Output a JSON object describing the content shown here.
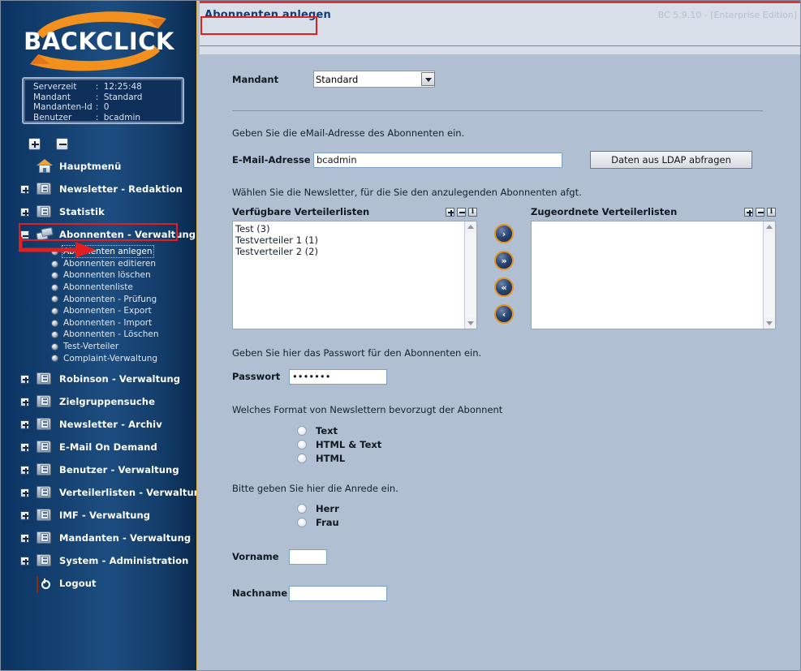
{
  "app": {
    "logo_text": "BACKCLICK",
    "version": "BC 5.9.10 - [Enterprise Edition]",
    "accent_orange": "#e8a33d",
    "sidebar_blue": "#14406f",
    "annotation_red": "#e02020",
    "body_blue": "#b0c0d2",
    "header_grey": "#d8dfe8"
  },
  "server_info": {
    "rows": [
      {
        "key": "Serverzeit",
        "sep": ":",
        "value": "12:25:48"
      },
      {
        "key": "Mandant",
        "sep": ":",
        "value": "Standard"
      },
      {
        "key": "Mandanten-Id",
        "sep": ":",
        "value": "0"
      },
      {
        "key": "Benutzer",
        "sep": ":",
        "value": "bcadmin"
      }
    ]
  },
  "tree_tools": {
    "expand_all": "expand-all-icon",
    "collapse_all": "collapse-all-icon"
  },
  "sidebar": {
    "items": [
      {
        "label": "Hauptmenü",
        "icon": "house-icon",
        "twisty": "none",
        "children": []
      },
      {
        "label": "Newsletter - Redaktion",
        "icon": "folder-icon",
        "twisty": "plus",
        "children": []
      },
      {
        "label": "Statistik",
        "icon": "folder-icon",
        "twisty": "plus",
        "children": []
      },
      {
        "label": "Abonnenten - Verwaltung",
        "icon": "cards-icon",
        "twisty": "minus",
        "highlighted": true,
        "children": [
          {
            "label": "Abonnenten anlegen",
            "selected": true
          },
          {
            "label": "Abonnenten editieren"
          },
          {
            "label": "Abonnenten löschen"
          },
          {
            "label": "Abonnentenliste"
          },
          {
            "label": "Abonnenten - Prüfung"
          },
          {
            "label": "Abonnenten - Export"
          },
          {
            "label": "Abonnenten - Import"
          },
          {
            "label": "Abonnenten - Löschen"
          },
          {
            "label": "Test-Verteiler"
          },
          {
            "label": "Complaint-Verwaltung"
          }
        ]
      },
      {
        "label": "Robinson - Verwaltung",
        "icon": "folder-icon",
        "twisty": "plus",
        "children": []
      },
      {
        "label": "Zielgruppensuche",
        "icon": "folder-icon",
        "twisty": "plus",
        "children": []
      },
      {
        "label": "Newsletter - Archiv",
        "icon": "folder-icon",
        "twisty": "plus",
        "children": []
      },
      {
        "label": "E-Mail On Demand",
        "icon": "folder-icon",
        "twisty": "plus",
        "children": []
      },
      {
        "label": "Benutzer - Verwaltung",
        "icon": "folder-icon",
        "twisty": "plus",
        "children": []
      },
      {
        "label": "Verteilerlisten - Verwaltung",
        "icon": "folder-icon",
        "twisty": "plus",
        "children": []
      },
      {
        "label": "IMF - Verwaltung",
        "icon": "folder-icon",
        "twisty": "plus",
        "children": []
      },
      {
        "label": "Mandanten - Verwaltung",
        "icon": "folder-icon",
        "twisty": "plus",
        "children": []
      },
      {
        "label": "System - Administration",
        "icon": "folder-icon",
        "twisty": "plus",
        "children": []
      },
      {
        "label": "Logout",
        "icon": "logout-icon",
        "twisty": "none",
        "children": []
      }
    ]
  },
  "page": {
    "title": "Abonnenten anlegen"
  },
  "form": {
    "mandant_label": "Mandant",
    "mandant_value": "Standard",
    "mandant_options": [
      "Standard"
    ],
    "email_hint": "Geben Sie die eMail-Adresse des Abonnenten ein.",
    "email_label": "E-Mail-Adresse",
    "email_value": "bcadmin",
    "email_placeholder": "",
    "ldap_button": "Daten aus LDAP abfragen",
    "lists_hint": "Wählen Sie die Newsletter, für die Sie den anzulegenden Abonnenten afgt.",
    "available_label": "Verfügbare Verteilerlisten",
    "assigned_label": "Zugeordnete Verteilerlisten",
    "available_items": [
      "Test (3)",
      "Testverteiler 1 (1)",
      "Testverteiler 2 (2)"
    ],
    "assigned_items": [],
    "transfer_buttons": [
      {
        "glyph": "›",
        "name": "move-right-button"
      },
      {
        "glyph": "»",
        "name": "move-all-right-button"
      },
      {
        "glyph": "«",
        "name": "move-all-left-button"
      },
      {
        "glyph": "‹",
        "name": "move-left-button"
      }
    ],
    "password_hint": "Geben Sie hier das Passwort für den Abonnenten ein.",
    "password_label": "Passwort",
    "password_value": "1234567",
    "format_hint": "Welches Format von Newslettern bevorzugt der Abonnent",
    "format_options": [
      {
        "label": "Text",
        "checked": false
      },
      {
        "label": "HTML & Text",
        "checked": false
      },
      {
        "label": "HTML",
        "checked": false
      }
    ],
    "salutation_hint": "Bitte geben Sie hier die Anrede ein.",
    "salutation_options": [
      {
        "label": "Herr",
        "checked": false
      },
      {
        "label": "Frau",
        "checked": false
      }
    ],
    "firstname_label": "Vorname",
    "firstname_value": "",
    "lastname_label": "Nachname",
    "lastname_value": ""
  },
  "listbox_tools": {
    "plus": "expand-icon",
    "minus": "collapse-icon",
    "info": "i"
  }
}
